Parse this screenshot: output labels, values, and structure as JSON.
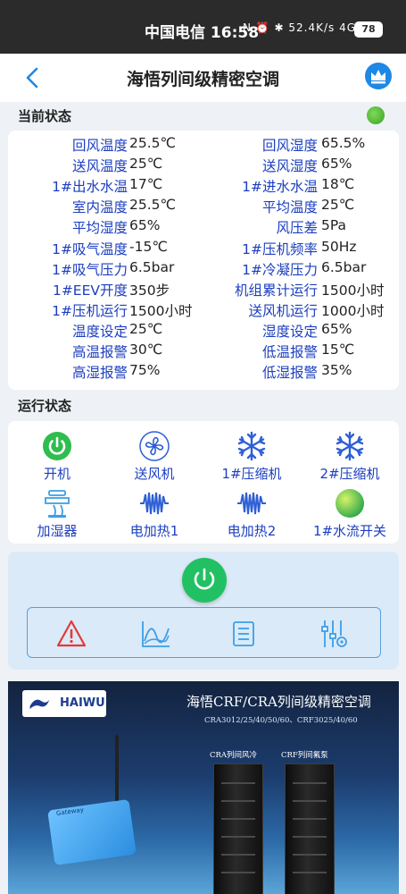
{
  "statusbar": {
    "carrier_time": "中国电信 16:58",
    "icons": "N ⏰ ✱ 52.4K/s 4G ▮ ⌔",
    "battery": "78"
  },
  "header": {
    "title": "海悟列间级精密空调",
    "back_icon": "chevron-left-icon",
    "crown_icon": "crown-icon"
  },
  "current_status": {
    "title": "当前状态",
    "online_color": "#4cc03a",
    "rows": [
      {
        "l1": "回风温度",
        "v1": "25.5℃",
        "l2": "回风湿度",
        "v2": "65.5%"
      },
      {
        "l1": "送风温度",
        "v1": "25℃",
        "l2": "送风湿度",
        "v2": "65%"
      },
      {
        "l1": "1#出水水温",
        "v1": "17℃",
        "l2": "1#进水水温",
        "v2": "18℃"
      },
      {
        "l1": "室内温度",
        "v1": "25.5℃",
        "l2": "平均温度",
        "v2": "25℃"
      },
      {
        "l1": "平均湿度",
        "v1": "65%",
        "l2": "风压差",
        "v2": "5Pa"
      },
      {
        "l1": "1#吸气温度",
        "v1": "-15℃",
        "l2": "1#压机频率",
        "v2": "50Hz"
      },
      {
        "l1": "1#吸气压力",
        "v1": "6.5bar",
        "l2": "1#冷凝压力",
        "v2": "6.5bar"
      },
      {
        "l1": "1#EEV开度",
        "v1": "350步",
        "l2": "机组累计运行",
        "v2": "1500小时"
      },
      {
        "l1": "1#压机运行",
        "v1": "1500小时",
        "l2": "送风机运行",
        "v2": "1000小时"
      },
      {
        "l1": "温度设定",
        "v1": "25℃",
        "l2": "湿度设定",
        "v2": "65%"
      },
      {
        "l1": "高温报警",
        "v1": "30℃",
        "l2": "低温报警",
        "v2": "15℃"
      },
      {
        "l1": "高湿报警",
        "v1": "75%",
        "l2": "低湿报警",
        "v2": "35%"
      }
    ]
  },
  "run_status": {
    "title": "运行状态",
    "items": [
      {
        "label": "开机",
        "icon": "power-on-icon"
      },
      {
        "label": "送风机",
        "icon": "fan-icon"
      },
      {
        "label": "1#压缩机",
        "icon": "snowflake-icon"
      },
      {
        "label": "2#压缩机",
        "icon": "snowflake-icon"
      },
      {
        "label": "加湿器",
        "icon": "humidifier-icon"
      },
      {
        "label": "电加热1",
        "icon": "heater-icon"
      },
      {
        "label": "电加热2",
        "icon": "heater-icon"
      },
      {
        "label": "1#水流开关",
        "icon": "water-flow-switch-icon"
      }
    ]
  },
  "controls": {
    "power_icon": "power-button-icon",
    "tools": [
      "alarm-icon",
      "chart-icon",
      "list-icon",
      "settings-sliders-icon"
    ]
  },
  "banner": {
    "logo": "HAIWU",
    "headline": "海悟CRF/CRA列间级精密空调",
    "models": "CRA3012/25/40/50/60、CRF3025/40/60",
    "caption_left": "CRA列间风冷",
    "caption_right": "CRF列间氟泵",
    "gateway_label": "Gateway"
  }
}
